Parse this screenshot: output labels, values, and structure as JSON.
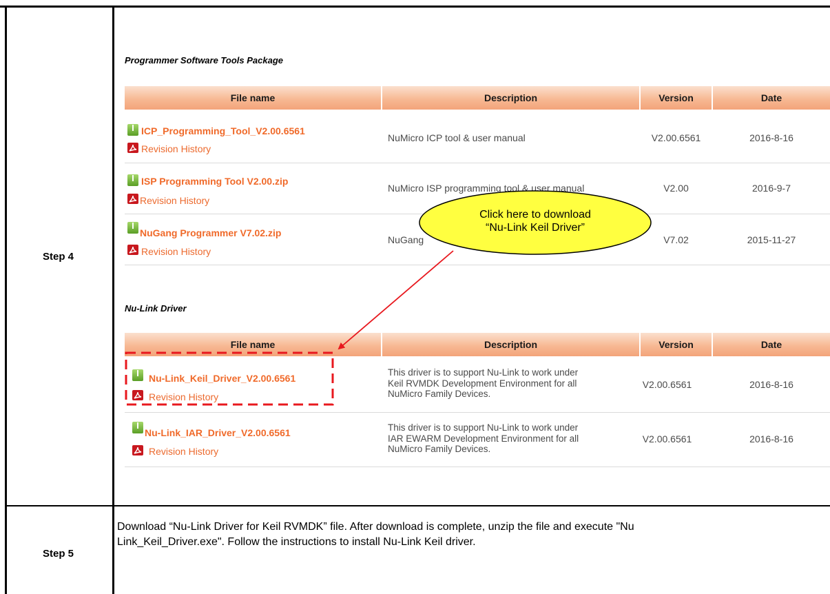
{
  "steps": {
    "step4": "Step 4",
    "step5": "Step 5"
  },
  "section_programmer": {
    "title": "Programmer Software Tools Package",
    "headers": [
      "File name",
      "Description",
      "Version",
      "Date"
    ],
    "rows": [
      {
        "file": "ICP_Programming_Tool_V2.00.6561",
        "revision": "Revision History",
        "description": "NuMicro ICP tool & user manual",
        "version": "V2.00.6561",
        "date": "2016-8-16"
      },
      {
        "file": "ISP Programming Tool V2.00.zip",
        "revision": "Revision History",
        "description": "NuMicro ISP programming tool & user manual",
        "version": "V2.00",
        "date": "2016-9-7"
      },
      {
        "file": "NuGang Programmer V7.02.zip",
        "revision": "Revision History",
        "description": "NuGang",
        "version": "V7.02",
        "date": "2015-11-27"
      }
    ]
  },
  "section_driver": {
    "title": "Nu-Link Driver",
    "headers": [
      "File name",
      "Description",
      "Version",
      "Date"
    ],
    "rows": [
      {
        "file": "Nu-Link_Keil_Driver_V2.00.6561",
        "revision": "Revision History",
        "description": [
          "This driver is to support Nu-Link to work under",
          "Keil RVMDK Development Environment for all",
          "NuMicro Family Devices."
        ],
        "version": "V2.00.6561",
        "date": "2016-8-16"
      },
      {
        "file": "Nu-Link_IAR_Driver_V2.00.6561",
        "revision": "Revision History",
        "description": [
          "This driver is to support Nu-Link to work under",
          "IAR EWARM Development Environment for all",
          "NuMicro Family Devices."
        ],
        "version": "V2.00.6561",
        "date": "2016-8-16"
      }
    ]
  },
  "callout": {
    "line1": "Click here to download",
    "line2": "“Nu-Link Keil Driver”"
  },
  "step5_text": {
    "line1": "Download “Nu-Link Driver for Keil RVMDK” file. After download is complete, unzip the file and execute \"Nu",
    "line2": "Link_Keil_Driver.exe\". Follow the instructions to install Nu-Link Keil driver."
  },
  "colors": {
    "link_orange": "#f06a2a",
    "callout_fill": "#ffff40",
    "arrow_red": "#e8181e",
    "header_peach": "#f7b994"
  }
}
